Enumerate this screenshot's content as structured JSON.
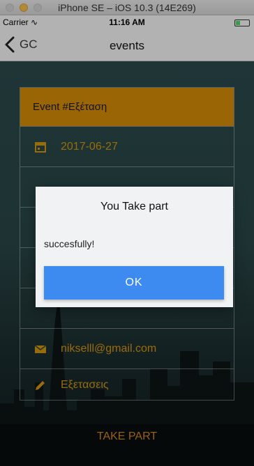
{
  "simulator": {
    "title": "iPhone SE – iOS 10.3 (14E269)"
  },
  "status_bar": {
    "carrier": "Carrier",
    "time": "11:16 AM"
  },
  "nav": {
    "back_label": "GC",
    "title": "events"
  },
  "event": {
    "header": "Event #Εξέταση",
    "date": "2017-06-27",
    "email": "nikselll@gmail.com",
    "description": "Εξετασεις"
  },
  "take_part_label": "TAKE PART",
  "alert": {
    "title": "You Take part",
    "message": "succesfully!",
    "ok_label": "OK"
  },
  "colors": {
    "accent": "#d68c06",
    "text_gold": "#d4960e",
    "button_blue": "#3d8bf0"
  }
}
